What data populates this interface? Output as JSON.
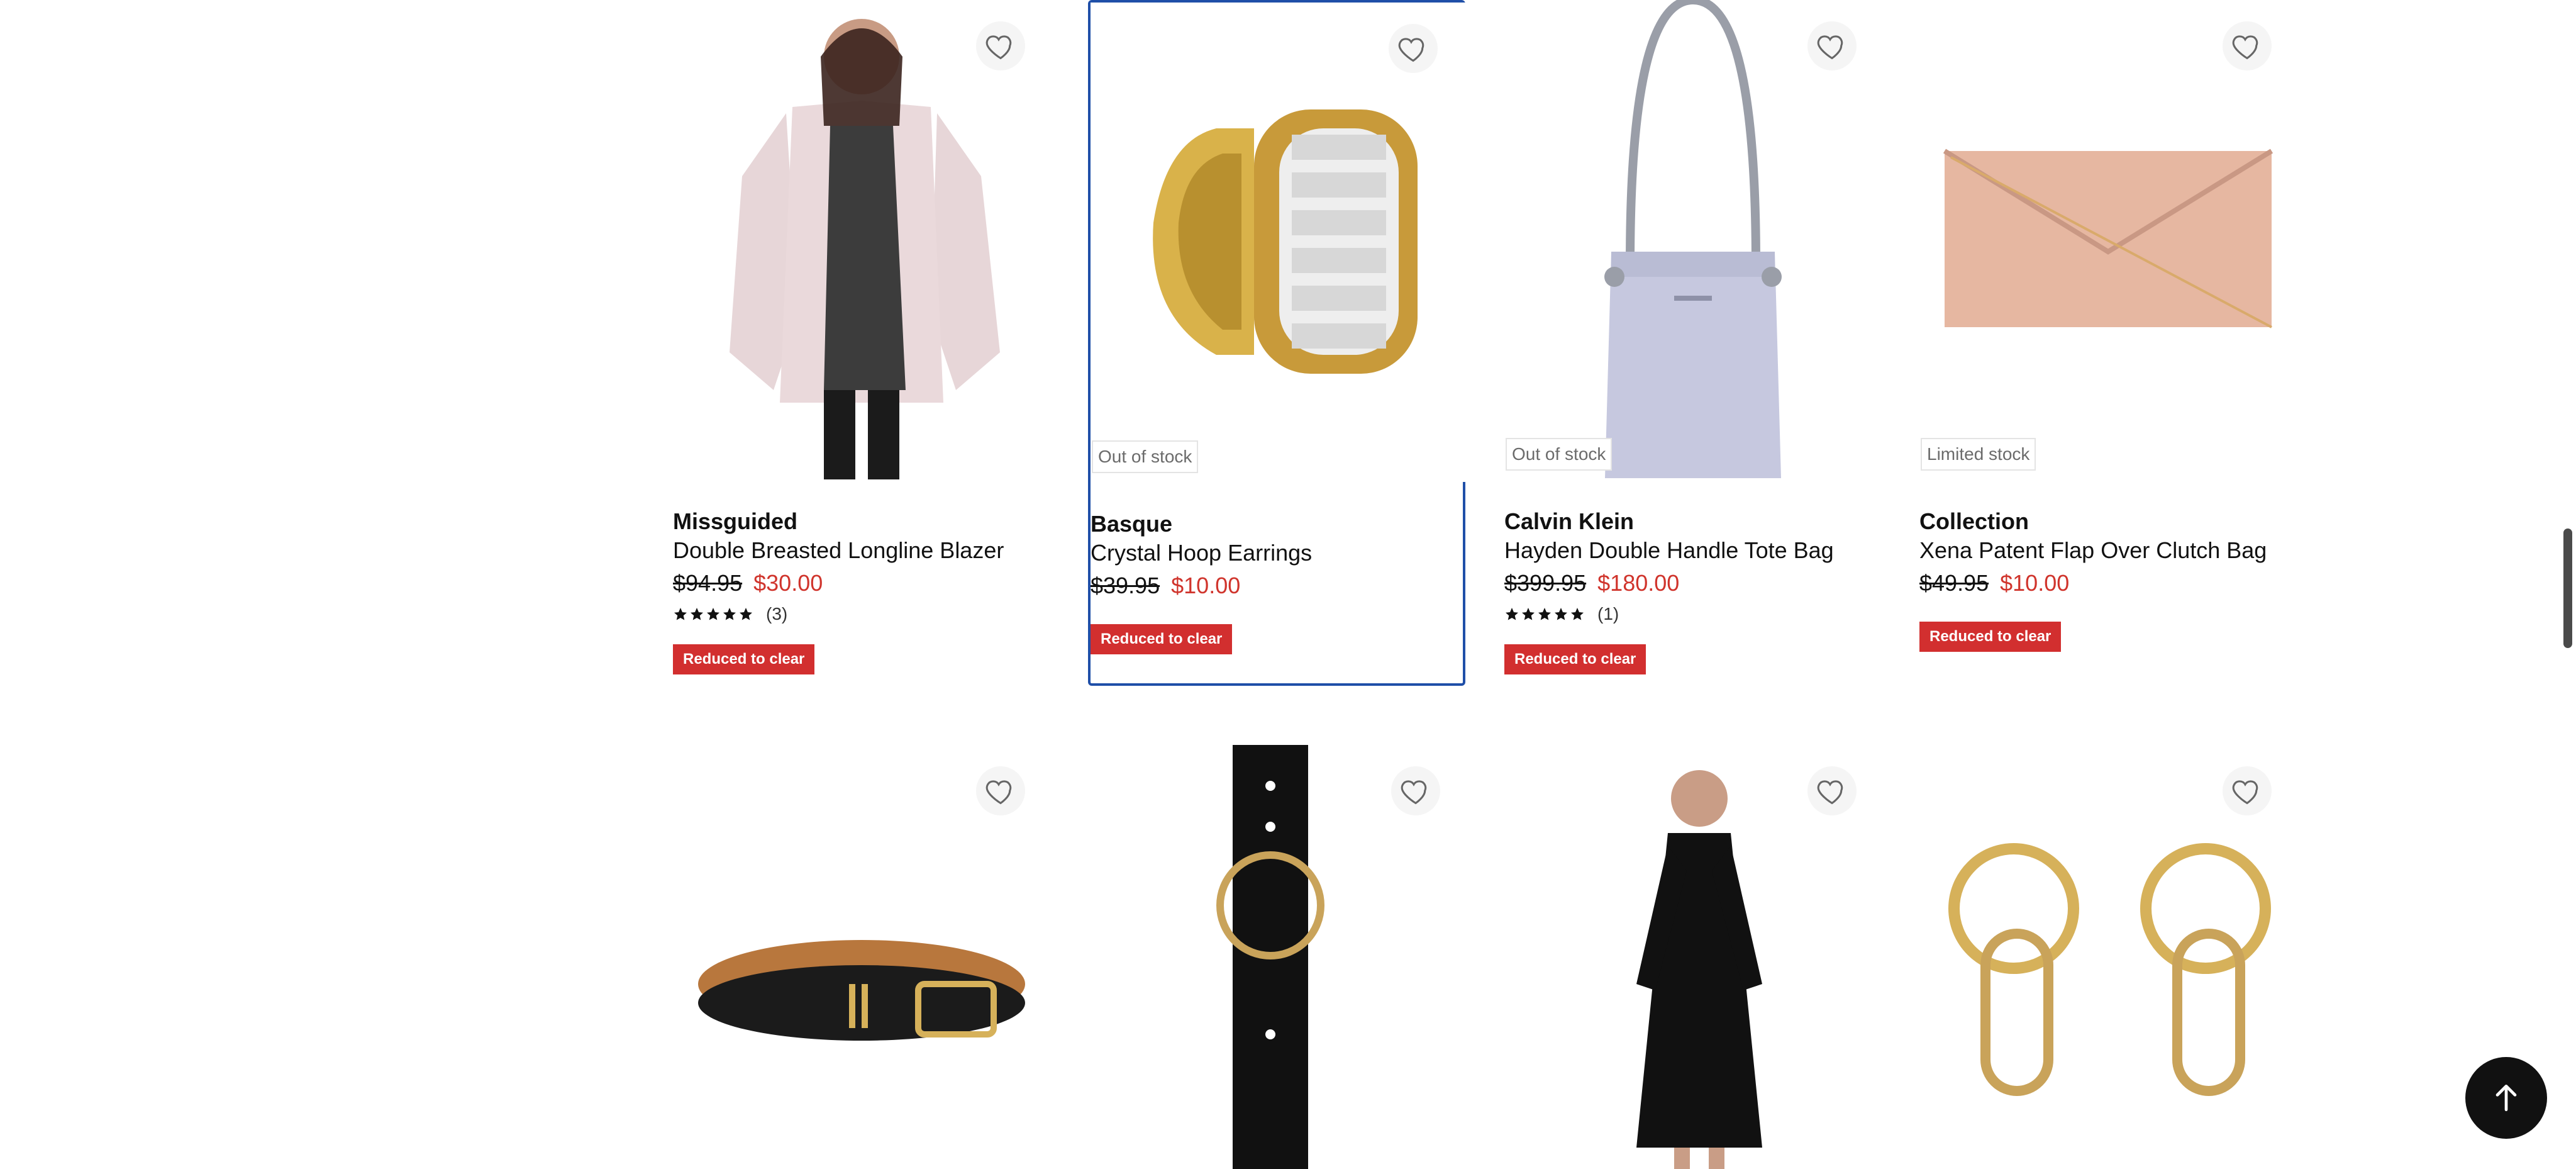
{
  "products_row1": [
    {
      "brand": "Missguided",
      "name": "Double Breasted Longline Blazer",
      "was": "$94.95",
      "now": "$30.00",
      "reviews": "(3)",
      "tag": "Reduced to clear",
      "stock": ""
    },
    {
      "brand": "Basque",
      "name": "Crystal Hoop Earrings",
      "was": "$39.95",
      "now": "$10.00",
      "reviews": "",
      "tag": "Reduced to clear",
      "stock": "Out of stock"
    },
    {
      "brand": "Calvin Klein",
      "name": "Hayden Double Handle Tote Bag",
      "was": "$399.95",
      "now": "$180.00",
      "reviews": "(1)",
      "tag": "Reduced to clear",
      "stock": "Out of stock"
    },
    {
      "brand": "Collection",
      "name": "Xena Patent Flap Over Clutch Bag",
      "was": "$49.95",
      "now": "$10.00",
      "reviews": "",
      "tag": "Reduced to clear",
      "stock": "Limited stock"
    }
  ],
  "products_row2_icons": [
    "belt-image",
    "belt-image",
    "dress-image",
    "earrings-image"
  ],
  "icons": {
    "wishlist": "heart-outline-icon",
    "back_to_top": "arrow-up-icon",
    "star": "star-icon"
  },
  "colors": {
    "sale_red": "#d0342c",
    "tag_red": "#d22f2f",
    "focus_blue": "#1f4fa8"
  }
}
